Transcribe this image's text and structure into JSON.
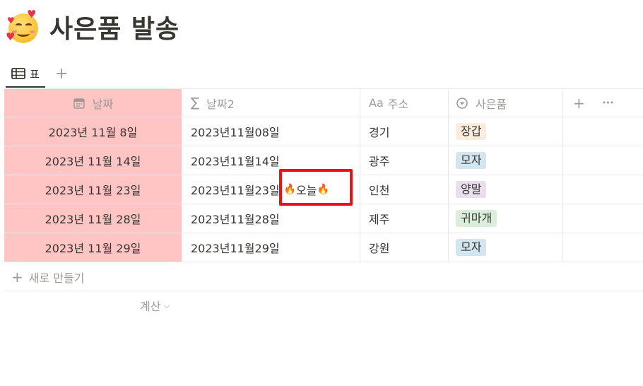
{
  "page": {
    "title": "사은품 발송"
  },
  "views": {
    "table_tab": "표",
    "add_view": "+"
  },
  "columns": {
    "date": "날짜",
    "date2": "날짜2",
    "address": "주소",
    "gift": "사은품",
    "add": "+",
    "more": "•••"
  },
  "rows": [
    {
      "date": "2023년 11월 8일",
      "date2": "2023년11월08일",
      "address": "경기",
      "gift": "장갑"
    },
    {
      "date": "2023년 11월 14일",
      "date2": "2023년11월14일",
      "address": "광주",
      "gift": "모자"
    },
    {
      "date": "2023년 11월 23일",
      "date2": "2023년11월23일",
      "today": "오늘",
      "address": "인천",
      "gift": "양말"
    },
    {
      "date": "2023년 11월 28일",
      "date2": "2023년11월28일",
      "address": "제주",
      "gift": "귀마개"
    },
    {
      "date": "2023년 11월 29일",
      "date2": "2023년11월29일",
      "address": "강원",
      "gift": "모자"
    }
  ],
  "footer": {
    "new_label": "새로 만들기",
    "calc_label": "계산"
  },
  "colors": {
    "date_column_bg": "#ffc4c4",
    "highlight_border": "#ee1111",
    "tag_orange": "#fbecdd",
    "tag_blue": "#d3e5ef",
    "tag_purple": "#e8deee",
    "tag_green": "#dbeddb"
  },
  "icons": {
    "title": "smiling-face-with-hearts-icon",
    "table_view": "table-icon",
    "date_col": "calendar-icon",
    "date2_col": "sigma-icon",
    "address_col": "text-icon",
    "gift_col": "select-icon",
    "today": "fire-icon"
  }
}
